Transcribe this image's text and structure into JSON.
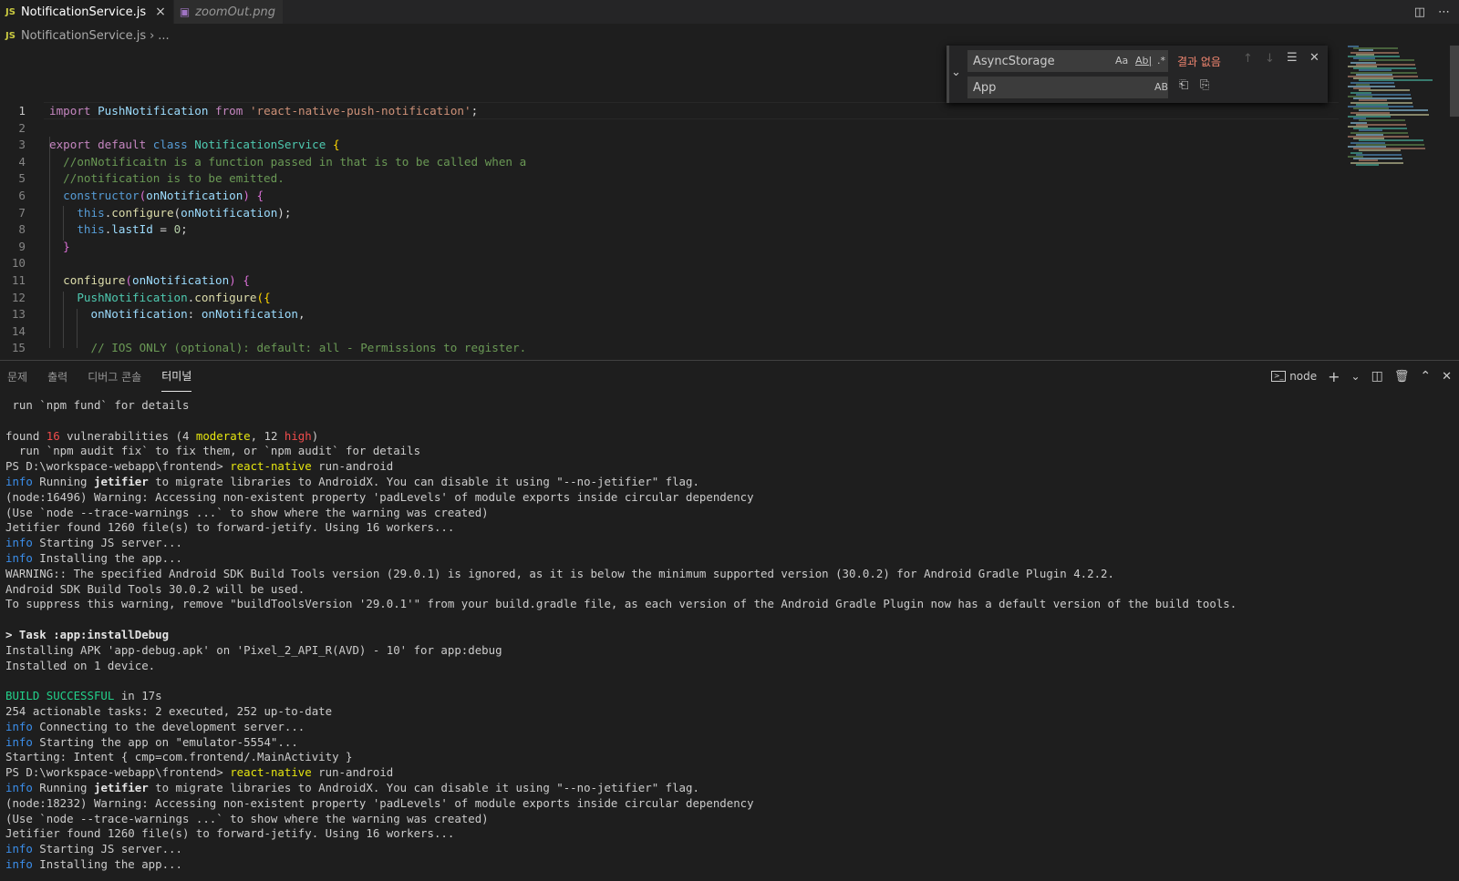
{
  "tabs": [
    {
      "icon": "JS",
      "label": "NotificationService.js",
      "close": "×"
    },
    {
      "label": "zoomOut.png"
    }
  ],
  "breadcrumb": {
    "icon": "JS",
    "file": "NotificationService.js",
    "sep": "›",
    "more": "..."
  },
  "find": {
    "search_value": "AsyncStorage",
    "replace_value": "App",
    "opt_case": "Aa",
    "opt_word": "Ab|",
    "opt_regex": ".*",
    "opt_preserve": "AB",
    "no_results": "결과 없음"
  },
  "editor": {
    "lines": [
      {
        "n": "1",
        "html": "<span class='kp'>import</span> <span class='v'>PushNotification</span> <span class='kp'>from</span> <span class='s'>'react-native-push-notification'</span><span class='p'>;</span>"
      },
      {
        "n": "2",
        "html": ""
      },
      {
        "n": "3",
        "html": "<span class='kp'>export</span> <span class='kp'>default</span> <span class='k'>class</span> <span class='cls'>NotificationService</span> <span class='b1'>{</span>"
      },
      {
        "n": "4",
        "html": "  <span class='cm'>//onNotificaitn is a function passed in that is to be called when a</span>"
      },
      {
        "n": "5",
        "html": "  <span class='cm'>//notification is to be emitted.</span>"
      },
      {
        "n": "6",
        "html": "  <span class='k'>constructor</span><span class='b2'>(</span><span class='v'>onNotification</span><span class='b2'>)</span> <span class='b2'>{</span>"
      },
      {
        "n": "7",
        "html": "    <span class='k'>this</span><span class='p'>.</span><span class='fn'>configure</span><span class='p'>(</span><span class='v'>onNotification</span><span class='p'>);</span>"
      },
      {
        "n": "8",
        "html": "    <span class='k'>this</span><span class='p'>.</span><span class='v'>lastId</span> <span class='p'>=</span> <span class='n'>0</span><span class='p'>;</span>"
      },
      {
        "n": "9",
        "html": "  <span class='b2'>}</span>"
      },
      {
        "n": "10",
        "html": ""
      },
      {
        "n": "11",
        "html": "  <span class='fn'>configure</span><span class='b2'>(</span><span class='v'>onNotification</span><span class='b2'>)</span> <span class='b2'>{</span>"
      },
      {
        "n": "12",
        "html": "    <span class='cls'>PushNotification</span><span class='p'>.</span><span class='fn'>configure</span><span class='b1'>({</span>"
      },
      {
        "n": "13",
        "html": "      <span class='v'>onNotification</span><span class='p'>:</span> <span class='v'>onNotification</span><span class='p'>,</span>"
      },
      {
        "n": "14",
        "html": ""
      },
      {
        "n": "15",
        "html": "      <span class='cm'>// IOS ONLY (optional): default: all - Permissions to register.</span>"
      }
    ]
  },
  "panel": {
    "tabs": [
      "문제",
      "출력",
      "디버그 콘솔",
      "터미널"
    ],
    "active_tab": "터미널",
    "terminal_name": "node",
    "icons": {
      "add": "+",
      "dropdown": "⌄",
      "split": "◫",
      "trash": "🗑",
      "maximize": "⌃",
      "close": "✕"
    }
  },
  "terminal": {
    "lines": [
      " run `npm fund` for details",
      "",
      "found <span class='t-red'>16</span> vulnerabilities (4 <span class='t-yel'>moderate</span>, 12 <span class='t-red'>high</span>)",
      "  run `npm audit fix` to fix them, or `npm audit` for details",
      "PS D:\\workspace-webapp\\frontend> <span class='t-yel'>react-native</span> run-android",
      "<span class='t-blu'>info</span> Running <span class='t-b'>jetifier</span> to migrate libraries to AndroidX. You can disable it using \"--no-jetifier\" flag.",
      "(node:16496) Warning: Accessing non-existent property 'padLevels' of module exports inside circular dependency",
      "(Use `node --trace-warnings ...` to show where the warning was created)",
      "Jetifier found 1260 file(s) to forward-jetify. Using 16 workers...",
      "<span class='t-blu'>info</span> Starting JS server...",
      "<span class='t-blu'>info</span> Installing the app...",
      "WARNING:: The specified Android SDK Build Tools version (29.0.1) is ignored, as it is below the minimum supported version (30.0.2) for Android Gradle Plugin 4.2.2.",
      "Android SDK Build Tools 30.0.2 will be used.",
      "To suppress this warning, remove \"buildToolsVersion '29.0.1'\" from your build.gradle file, as each version of the Android Gradle Plugin now has a default version of the build tools.",
      "",
      "<span class='t-b'>&gt; Task :app:installDebug</span>",
      "Installing APK 'app-debug.apk' on 'Pixel_2_API_R(AVD) - 10' for app:debug",
      "Installed on 1 device.",
      "",
      "<span class='t-grn'>BUILD SUCCESSFUL</span> in 17s",
      "254 actionable tasks: 2 executed, 252 up-to-date",
      "<span class='t-blu'>info</span> Connecting to the development server...",
      "<span class='t-blu'>info</span> Starting the app on \"emulator-5554\"...",
      "Starting: Intent { cmp=com.frontend/.MainActivity }",
      "PS D:\\workspace-webapp\\frontend> <span class='t-yel'>react-native</span> run-android",
      "<span class='t-blu'>info</span> Running <span class='t-b'>jetifier</span> to migrate libraries to AndroidX. You can disable it using \"--no-jetifier\" flag.",
      "(node:18232) Warning: Accessing non-existent property 'padLevels' of module exports inside circular dependency",
      "(Use `node --trace-warnings ...` to show where the warning was created)",
      "Jetifier found 1260 file(s) to forward-jetify. Using 16 workers...",
      "<span class='t-blu'>info</span> Starting JS server...",
      "<span class='t-blu'>info</span> Installing the app..."
    ]
  },
  "colors": {
    "bg": "#1e1e1e",
    "tabbar": "#252526",
    "accent": "#007acc",
    "info": "#3b8eea",
    "success": "#23d18b",
    "warn": "#e5e510",
    "error": "#f14c4c"
  }
}
